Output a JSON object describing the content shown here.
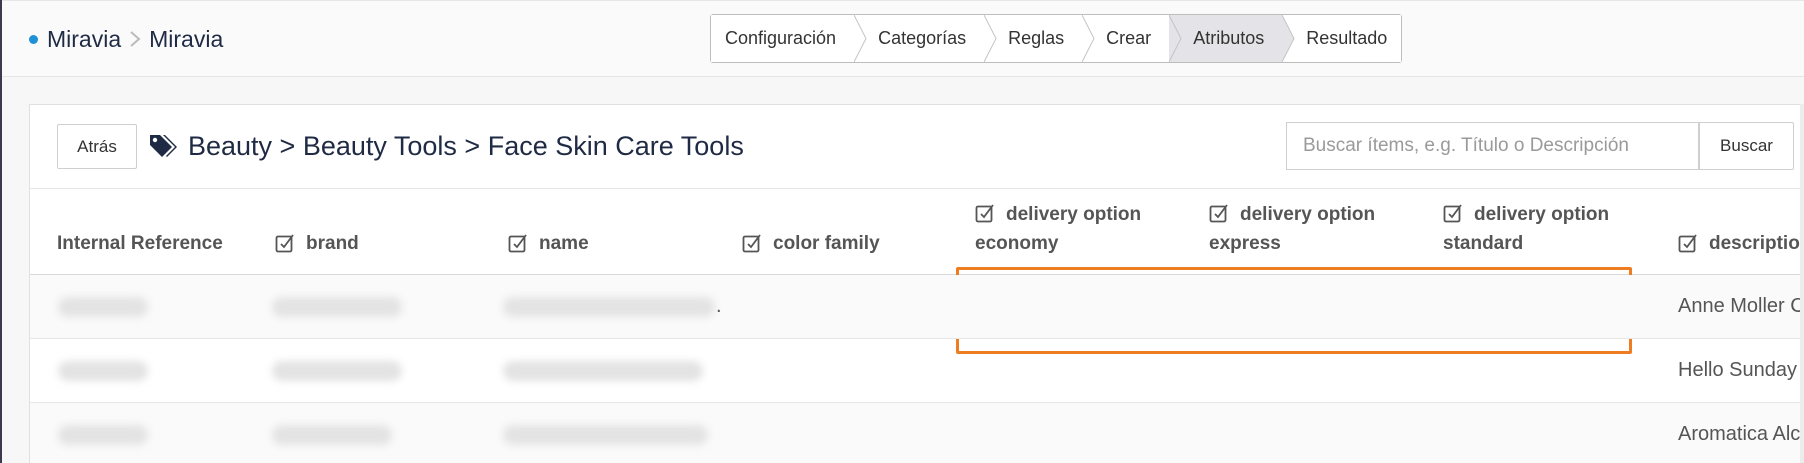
{
  "breadcrumb": {
    "root": "Miravia",
    "current": "Miravia"
  },
  "wizard": {
    "steps": [
      {
        "label": "Configuración",
        "active": false
      },
      {
        "label": "Categorías",
        "active": false
      },
      {
        "label": "Reglas",
        "active": false
      },
      {
        "label": "Crear",
        "active": false
      },
      {
        "label": "Atributos",
        "active": true
      },
      {
        "label": "Resultado",
        "active": false
      }
    ]
  },
  "header": {
    "back_label": "Atrás",
    "category_path": "Beauty > Beauty Tools > Face Skin Care Tools",
    "search_placeholder": "Buscar ítems, e.g. Título o Descripción",
    "search_label": "Buscar"
  },
  "table": {
    "columns": [
      {
        "label": "Internal Reference",
        "editable": false
      },
      {
        "label": "brand",
        "editable": true
      },
      {
        "label": "name",
        "editable": true
      },
      {
        "label": "color family",
        "editable": true
      },
      {
        "label_line1": "delivery option",
        "label_line2": "economy",
        "editable": true
      },
      {
        "label_line1": "delivery option",
        "label_line2": "express",
        "editable": true
      },
      {
        "label_line1": "delivery option",
        "label_line2": "standard",
        "editable": true
      },
      {
        "label": "descriptio",
        "editable": true
      }
    ],
    "rows": [
      {
        "description": "Anne Moller C",
        "name_suffix": "."
      },
      {
        "description": "Hello Sunday"
      },
      {
        "description": "Aromatica Alc"
      }
    ]
  },
  "colors": {
    "highlight": "#ee7d22",
    "accent_dot": "#1e90d6"
  }
}
